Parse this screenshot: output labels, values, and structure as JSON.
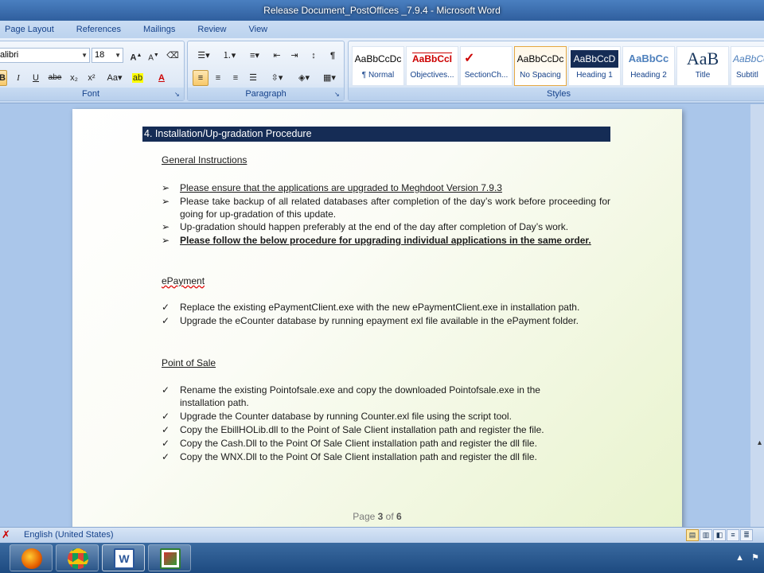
{
  "window": {
    "title": "Release Document_PostOffices _7.9.4  -  Microsoft Word"
  },
  "ribbon_tabs": [
    "Page Layout",
    "References",
    "Mailings",
    "Review",
    "View"
  ],
  "font_group": {
    "font_name": "alibri",
    "font_size": "18",
    "label": "Font"
  },
  "paragraph_group": {
    "label": "Paragraph"
  },
  "styles_group": {
    "label": "Styles",
    "styles": [
      {
        "sample": "AaBbCcDc",
        "name": "¶ Normal"
      },
      {
        "sample": "AaBbCcI",
        "name": "Objectives..."
      },
      {
        "sample": "✓",
        "name": "SectionCh..."
      },
      {
        "sample": "AaBbCcDc",
        "name": "No Spacing"
      },
      {
        "sample": "AaBbCcD",
        "name": "Heading 1"
      },
      {
        "sample": "AaBbCc",
        "name": "Heading 2"
      },
      {
        "sample": "AaB",
        "name": "Title"
      },
      {
        "sample": "AaBbCc",
        "name": "Subtitl"
      }
    ]
  },
  "document": {
    "heading": "4.  Installation/Up-gradation Procedure",
    "general": {
      "title": "General Instructions",
      "items": [
        "Please ensure that the applications are upgraded to Meghdoot Version 7.9.3",
        "Please take backup of all related databases after completion of the day’s work before proceeding for going for up-gradation of this update.",
        "Up-gradation should happen preferably at the end of the day after completion of Day’s work.",
        "Please follow the below procedure for upgrading individual applications in the same order."
      ]
    },
    "epayment": {
      "title": "ePayment",
      "items": [
        "Replace the existing ePaymentClient.exe with the new ePaymentClient.exe in installation path.",
        "Upgrade the eCounter database by running epayment exl file available in the ePayment folder."
      ]
    },
    "pos": {
      "title": "Point of Sale",
      "items": [
        "Rename the existing Pointofsale.exe and copy the downloaded Pointofsale.exe in the installation path.",
        "Upgrade the Counter database by running Counter.exl file using the script tool.",
        "Copy the EbillHOLib.dll to the Point of Sale Client installation path and register the file.",
        "Copy the Cash.Dll to the Point Of Sale Client installation path and register the dll file.",
        "Copy the WNX.Dll to the Point Of Sale Client installation path and register the dll file."
      ]
    },
    "page_prefix": "Page",
    "page_current": "3",
    "page_of": "of",
    "page_total": "6"
  },
  "status": {
    "language": "English (United States)"
  },
  "colors": {
    "heading_bar": "#152c55",
    "titlebar": "#2f5f9e",
    "ribbon": "#dbe7f6"
  }
}
